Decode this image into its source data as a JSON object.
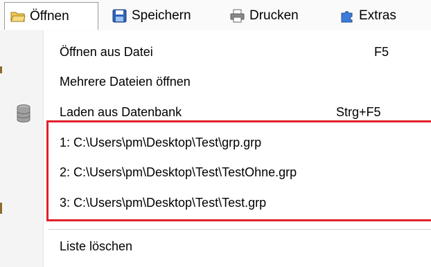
{
  "menubar": {
    "items": [
      {
        "label": "Öffnen",
        "icon": "folder-open-icon"
      },
      {
        "label": "Speichern",
        "icon": "save-icon"
      },
      {
        "label": "Drucken",
        "icon": "printer-icon"
      },
      {
        "label": "Extras",
        "icon": "puzzle-icon"
      }
    ]
  },
  "dropdown": {
    "open_file": {
      "label": "Öffnen aus Datei",
      "shortcut": "F5"
    },
    "open_multiple": {
      "label": "Mehrere Dateien öffnen"
    },
    "load_db": {
      "label": "Laden aus Datenbank",
      "shortcut": "Strg+F5",
      "icon": "database-icon"
    },
    "recent": [
      "1: C:\\Users\\pm\\Desktop\\Test\\grp.grp",
      "2: C:\\Users\\pm\\Desktop\\Test\\TestOhne.grp",
      "3: C:\\Users\\pm\\Desktop\\Test\\Test.grp"
    ],
    "clear_list": {
      "label": "Liste löschen"
    }
  },
  "colors": {
    "highlight_border": "#e0202a",
    "gutter": "#f4f4f4"
  }
}
